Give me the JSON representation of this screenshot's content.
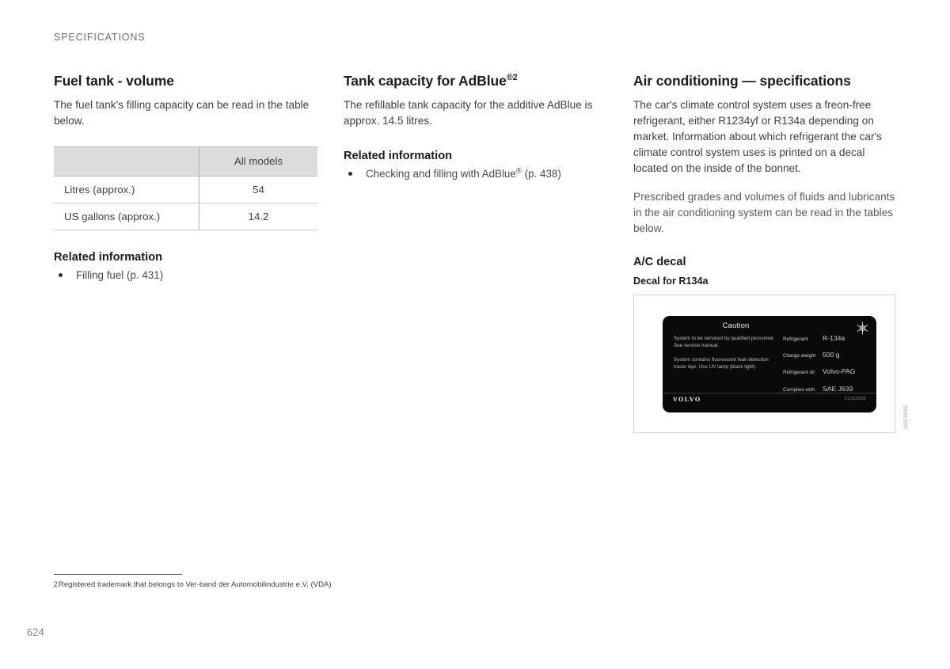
{
  "running_head": "SPECIFICATIONS",
  "folio": "624",
  "columns": {
    "fuel_tank": {
      "heading": "Fuel tank - volume",
      "intro": "The fuel tank's filling capacity can be read in the table below.",
      "table": {
        "headers": [
          "",
          "All models"
        ],
        "rows": [
          {
            "label": "Litres (approx.)",
            "value": "54"
          },
          {
            "label": "US gallons (approx.)",
            "value": "14.2"
          }
        ]
      },
      "related_heading": "Related information",
      "related_links": [
        "Filling fuel (p. 431)"
      ]
    },
    "adblue": {
      "heading": "Tank capacity for AdBlue",
      "heading_sup": "®2",
      "intro": "The refillable tank capacity for the additive AdBlue is approx. 14.5 litres.",
      "related_heading": "Related information",
      "related_links": [
        {
          "pre": "Checking and filling with AdBlue",
          "reg": "®",
          "post": "(p. 438)"
        }
      ]
    },
    "air_conditioning": {
      "heading": "Air conditioning — specifications",
      "paragraph_1": "The car's climate control system uses a freon-free refrigerant, either R1234yf or R134a depending on market. Information about which refrigerant the car's climate control system uses is printed on a decal located on the inside of the bonnet.",
      "paragraph_2": "Prescribed grades and volumes of fluids and lubricants in the air conditioning system can be read in the tables below.",
      "subheading": "A/C decal",
      "figure_caption": "Decal for R134a",
      "figure_id": "G052866",
      "decal": {
        "title": "Caution",
        "left_blocks": [
          "System to be serviced by qualified personnel. See service manual.",
          "System contains fluorescent leak detection tracer dye. Use UV lamp (black light)."
        ],
        "right_rows": [
          {
            "key": "Refrigerant",
            "value": "R-134a"
          },
          {
            "key": "Charge weight",
            "value": "500 g"
          },
          {
            "key": "Refrigerant oil",
            "value": "Volvo-PAG"
          },
          {
            "key": "Complies with:",
            "value": "SAE J639"
          }
        ],
        "brand": "VOLVO",
        "part_number": "31252525",
        "icon": "snowflake-icon"
      }
    }
  },
  "footnote": {
    "marker": "2",
    "text": "Registered trademark that belongs to Ver-band der Automobilindustrie e.V. (VDA)"
  }
}
